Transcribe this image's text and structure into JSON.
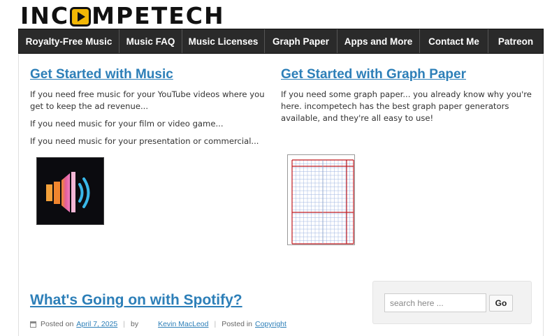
{
  "site": {
    "logo_left": "INC",
    "logo_right": "MPETECH"
  },
  "nav": {
    "items": [
      {
        "label": "Royalty-Free Music"
      },
      {
        "label": "Music FAQ"
      },
      {
        "label": "Music Licenses"
      },
      {
        "label": "Graph Paper"
      },
      {
        "label": "Apps and More"
      },
      {
        "label": "Contact Me"
      },
      {
        "label": "Patreon"
      }
    ]
  },
  "music": {
    "title": "Get Started with Music",
    "para1": "If you need free music for your YouTube videos where you get to keep the ad revenue...",
    "para2": "If you need music for your film or video game...",
    "para3": "If you need music for your presentation or commercial..."
  },
  "graph": {
    "title": "Get Started with Graph Paper",
    "para1": "If you need some graph paper... you already know why you're here. incompetech has the best graph paper generators available, and they're all easy to use!"
  },
  "post": {
    "title": "What's Going on with Spotify?",
    "posted_on_label": "Posted on",
    "date": "April 7, 2025",
    "by_label": "by",
    "author": "Kevin MacLeod",
    "posted_in_label": "Posted in",
    "category": "Copyright"
  },
  "search": {
    "placeholder": "search here ...",
    "button_label": "Go"
  },
  "icons": {
    "logo_play": "play-icon",
    "speaker": "speaker-icon",
    "graph": "graph-paper-icon",
    "calendar": "calendar-icon"
  },
  "colors": {
    "nav_bg": "#2a2a2a",
    "link": "#2d7fb8",
    "logo_accent": "#f2b705",
    "graph_red": "#c0191f",
    "graph_blue": "#9fb6e0"
  }
}
